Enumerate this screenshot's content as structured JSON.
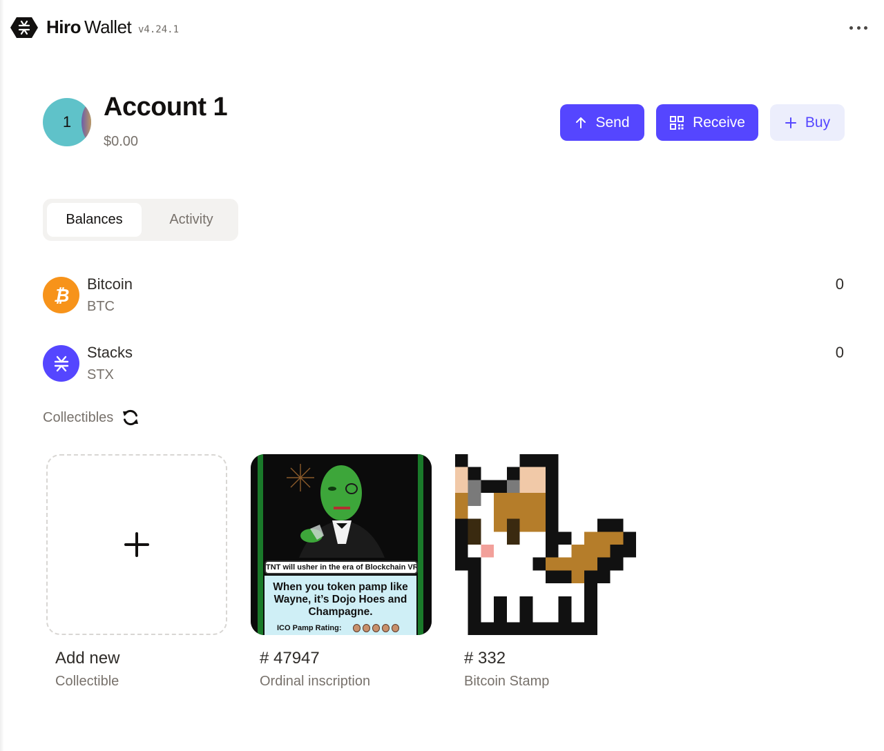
{
  "app": {
    "brand_bold": "Hiro",
    "brand_regular": "Wallet",
    "version": "v4.24.1"
  },
  "account": {
    "avatar_initial": "1",
    "name": "Account 1",
    "balance": "$0.00"
  },
  "actions": {
    "send_label": "Send",
    "receive_label": "Receive",
    "buy_label": "Buy"
  },
  "tabs": [
    {
      "label": "Balances",
      "active": true
    },
    {
      "label": "Activity",
      "active": false
    }
  ],
  "tokens": [
    {
      "name": "Bitcoin",
      "symbol": "BTC",
      "amount": "0",
      "icon": "bitcoin-icon",
      "color": "#f7931a"
    },
    {
      "name": "Stacks",
      "symbol": "STX",
      "amount": "0",
      "icon": "stacks-icon",
      "color": "#5546ff"
    }
  ],
  "collectibles": {
    "title": "Collectibles",
    "items": [
      {
        "title": "Add new",
        "subtitle": "Collectible"
      },
      {
        "title": "# 47947",
        "subtitle": "Ordinal inscription",
        "image_caption": "TNT will usher in the era of Blockchain VR",
        "image_text": "When you token pamp like Wayne, it’s Dojo Hoes and Champagne.",
        "image_rating": "ICO Pamp Rating:"
      },
      {
        "title": "# 332",
        "subtitle": "Bitcoin Stamp"
      }
    ]
  },
  "colors": {
    "accent": "#5546ff",
    "accent_light": "#eceefc",
    "bitcoin": "#f7931a",
    "avatar": "#5fc2c9"
  }
}
